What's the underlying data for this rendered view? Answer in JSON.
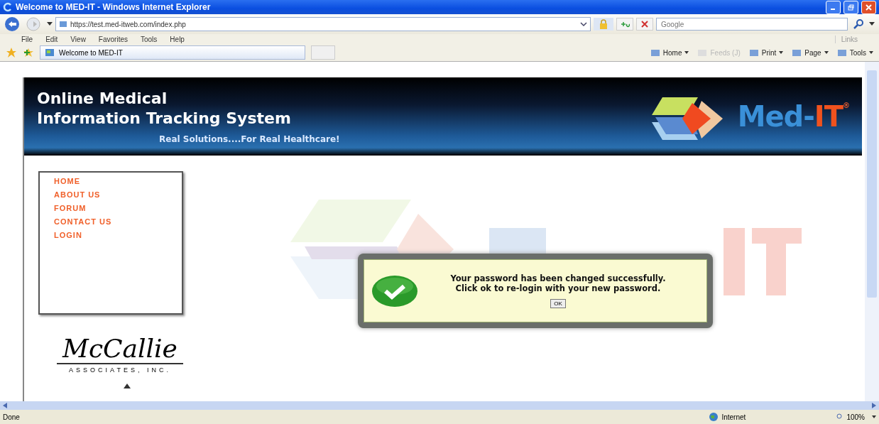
{
  "window": {
    "title": "Welcome to MED-IT - Windows Internet Explorer"
  },
  "address_bar": {
    "url": "https://test.med-itweb.com/index.php"
  },
  "search": {
    "placeholder": "Google"
  },
  "menu_bar": [
    "File",
    "Edit",
    "View",
    "Favorites",
    "Tools",
    "Help"
  ],
  "links_label": "Links",
  "tabs": [
    {
      "label": "Welcome to MED-IT",
      "selected": true
    }
  ],
  "command_bar": [
    {
      "label": "Home",
      "disabled": false,
      "menu": true
    },
    {
      "label": "Feeds (J)",
      "disabled": true,
      "menu": false
    },
    {
      "label": "Print",
      "disabled": false,
      "menu": true
    },
    {
      "label": "Page",
      "disabled": false,
      "menu": true
    },
    {
      "label": "Tools",
      "disabled": false,
      "menu": true
    }
  ],
  "banner": {
    "title_lines": [
      "Online Medical",
      "Information Tracking System"
    ],
    "tagline": "Real Solutions....For Real Healthcare!",
    "logo": {
      "prefix": "Med-",
      "suffix": "IT",
      "mark": "®"
    }
  },
  "nav": [
    {
      "label": "HOME"
    },
    {
      "label": "ABOUT US"
    },
    {
      "label": "FORUM"
    },
    {
      "label": "CONTACT US"
    },
    {
      "label": "LOGIN"
    }
  ],
  "company_logo": {
    "name": "McCallie",
    "subtitle": "ASSOCIATES, INC."
  },
  "dialog": {
    "message": "Your password has been changed successfully. Click ok to re-login with your new password.",
    "button": "OK"
  },
  "status_bar": {
    "text": "Done",
    "zone": "Internet",
    "zoom": "100%"
  }
}
